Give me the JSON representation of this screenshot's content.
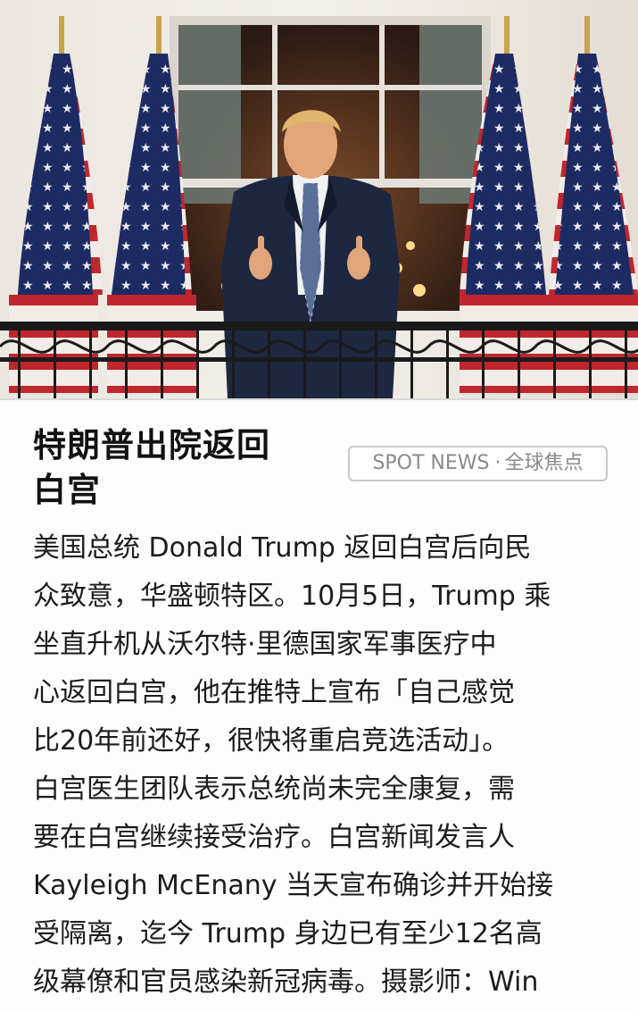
{
  "article": {
    "title_lines": [
      "特朗普出院返回",
      "白宫"
    ],
    "badge": {
      "label": "SPOT NEWS",
      "separator": "·",
      "category": "全球焦点"
    },
    "caption_lines": [
      "美国总统 Donald Trump 返回白宫后向民",
      "众致意，华盛顿特区。10月5日，Trump 乘",
      "坐直升机从沃尔特·里德国家军事医疗中",
      "心返回白宫，他在推特上宣布「自己感觉",
      "比20年前还好，很快将重启竞选活动」。",
      "白宫医生团队表示总统尚未完全康复，需",
      "要在白宫继续接受治疗。白宫新闻发言人",
      "Kayleigh McEnany 当天宣布确诊并开始接",
      "受隔离，迄今 Trump 身边已有至少12名高",
      "级幕僚和官员感染新冠病毒。摄影师：Win"
    ]
  },
  "colors": {
    "text": "#1c1c1c",
    "title": "#111111",
    "badge_text": "#8a8a8a",
    "badge_border": "#c9c9c9",
    "flag_red": "#c0262d",
    "flag_blue": "#1d2b63",
    "suit": "#1e2740"
  }
}
